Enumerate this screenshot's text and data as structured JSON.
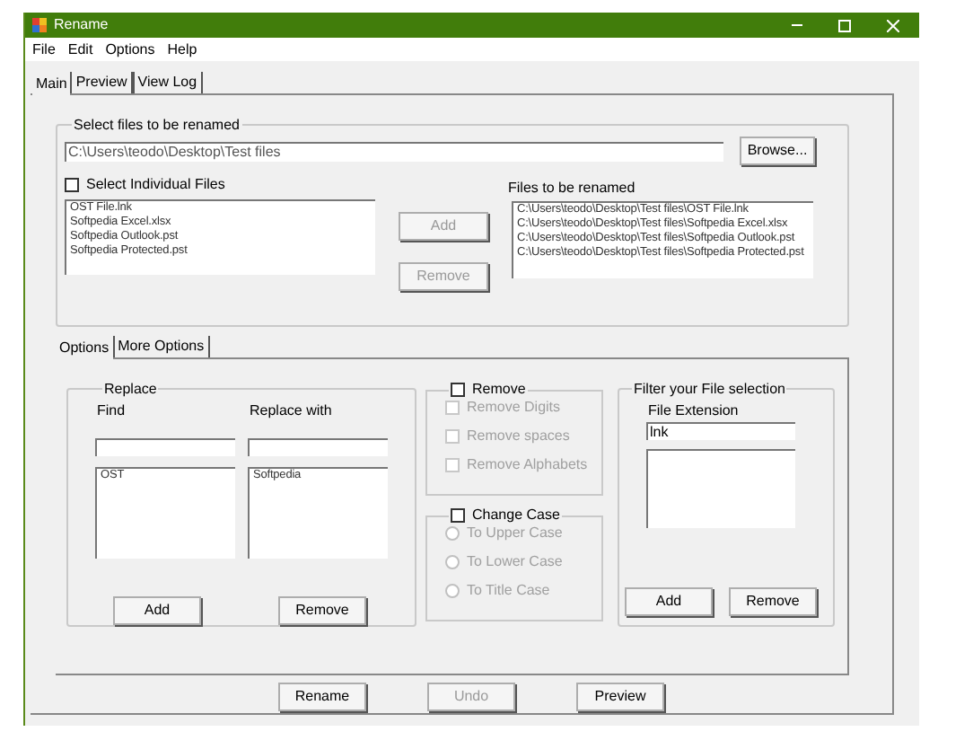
{
  "window": {
    "title": "Rename"
  },
  "menu": [
    "File",
    "Edit",
    "Options",
    "Help"
  ],
  "tabs": [
    {
      "label": "Main",
      "selected": true
    },
    {
      "label": "Preview",
      "selected": false
    },
    {
      "label": "View Log",
      "selected": false
    }
  ],
  "select_files": {
    "title": "Select files to be renamed",
    "path": "C:\\Users\\teodo\\Desktop\\Test files",
    "browse": "Browse...",
    "individual": {
      "label": "Select Individual Files",
      "checked": false
    },
    "source_files": [
      "OST File.lnk",
      "Softpedia Excel.xlsx",
      "Softpedia Outlook.pst",
      "Softpedia Protected.pst"
    ],
    "buttons": [
      {
        "label": "Add",
        "disabled": true
      },
      {
        "label": "Remove",
        "disabled": true
      }
    ],
    "target_label": "Files to be renamed",
    "target_files": [
      "C:\\Users\\teodo\\Desktop\\Test files\\OST File.lnk",
      "C:\\Users\\teodo\\Desktop\\Test files\\Softpedia Excel.xlsx",
      "C:\\Users\\teodo\\Desktop\\Test files\\Softpedia Outlook.pst",
      "C:\\Users\\teodo\\Desktop\\Test files\\Softpedia Protected.pst"
    ]
  },
  "option_tabs": [
    {
      "label": "Options",
      "selected": true
    },
    {
      "label": "More Options",
      "selected": false
    }
  ],
  "replace": {
    "title": "Replace",
    "find_label": "Find",
    "replace_label": "Replace with",
    "find_items": [
      "OST"
    ],
    "replace_items": [
      "Softpedia"
    ],
    "buttons": [
      {
        "label": "Add",
        "disabled": false
      },
      {
        "label": "Remove",
        "disabled": false
      }
    ]
  },
  "remove": {
    "label": "Remove",
    "checked": false,
    "options": [
      {
        "label": "Remove Digits",
        "checked": false,
        "disabled": true
      },
      {
        "label": "Remove spaces",
        "checked": false,
        "disabled": true
      },
      {
        "label": "Remove Alphabets",
        "checked": false,
        "disabled": true
      }
    ]
  },
  "change_case": {
    "label": "Change Case",
    "checked": false,
    "options": [
      {
        "label": "To Upper Case",
        "selected": false,
        "disabled": true
      },
      {
        "label": "To Lower Case",
        "selected": false,
        "disabled": true
      },
      {
        "label": "To Title Case",
        "selected": false,
        "disabled": true
      }
    ]
  },
  "filter": {
    "title": "Filter your File selection",
    "label": "File Extension",
    "value": "lnk",
    "buttons": [
      {
        "label": "Add",
        "disabled": false
      },
      {
        "label": "Remove",
        "disabled": false
      }
    ]
  },
  "actions": [
    {
      "label": "Rename",
      "disabled": false
    },
    {
      "label": "Undo",
      "disabled": true
    },
    {
      "label": "Preview",
      "disabled": false
    }
  ]
}
